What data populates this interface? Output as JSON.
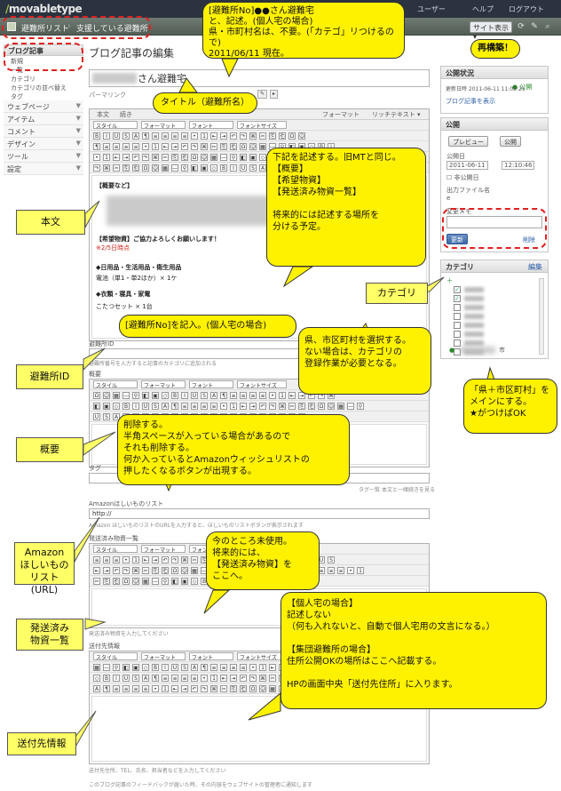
{
  "app": {
    "logo": "movabletype",
    "top_links": [
      "ユーザー",
      "ヘルプ",
      "ログアウト"
    ]
  },
  "site_bar": {
    "crumbs": [
      "避難所リスト",
      "支援している避難所"
    ],
    "view_site": "サイト表示"
  },
  "left_nav": {
    "items": [
      {
        "label": "ブログ記事",
        "sub": [
          "新規",
          "一覧",
          "カテゴリ",
          "カテゴリの並べ替え",
          "タグ"
        ]
      },
      {
        "label": "ウェブページ"
      },
      {
        "label": "アイテム"
      },
      {
        "label": "コメント"
      },
      {
        "label": "デザイン"
      },
      {
        "label": "ツール"
      },
      {
        "label": "設定"
      }
    ]
  },
  "main": {
    "page_title": "ブログ記事の編集",
    "title_value": "さん避難宅",
    "permalink_label": "パーマリンク",
    "format_label": "フォーマット",
    "format_value": "リッチテキスト",
    "editor_tabs": [
      "本文",
      "続き"
    ],
    "toolbar_selects": [
      "スタイル",
      "フォーマット",
      "フォント",
      "フォントサイズ"
    ],
    "body": {
      "section_overview": "【概要など】",
      "hope_label": "【希望物資】ご協力よろしくお願いします！",
      "hope_note": "※2/5日時点",
      "daily_label": "◆日用品・生活用品・衛生用品",
      "item_a": "電池（単1・単2ほか）× 1ケ",
      "clothes_label": "◆衣類・寝具・家電",
      "item_b": "こたつセット × 1台"
    },
    "shelter_id_label": "避難所ID",
    "shelter_id_note": "避難所番号を入力すると記事のカテゴリに追加される",
    "summary_label": "概要",
    "tags_label": "タグ",
    "tags_links": [
      "タグ一覧",
      "本文と一緒",
      "続きを見る"
    ],
    "amazon_label": "Amazonほしいものリスト",
    "amazon_value": "http://",
    "amazon_note": "Amazon ほしいものリストのURLを入力すると、ほしいものリストボタンが表示されます",
    "shipped_label": "発送済み物資一覧",
    "shipped_note": "発送済み物資を入力してください",
    "dest_label": "送付先情報",
    "dest_note": "送付先住所、TEL、氏名、担当者などを入力してください",
    "footer_text": "このブログ記事のフィードバックが届いた時、その内容をウェブサイトの管理者に通知します"
  },
  "sidebar": {
    "status_title": "公開状況",
    "status_value": "公開",
    "status_date": "更新日時 2011-06-11 11:09:21",
    "status_link": "ブログ記事を表示",
    "publish_title": "公開",
    "preview_btn": "プレビュー",
    "save_btn": "公開",
    "publish_date_label": "公開日",
    "publish_date": "2011-06-11",
    "publish_time": "12:10:46",
    "unpublish_label": "非公開日",
    "filename_label": "出力ファイル名",
    "filename_value": "e",
    "change_label": "変更メモ",
    "update_btn": "更新",
    "delete_link": "削除",
    "category_title": "カテゴリ",
    "category_action": "編集",
    "category_add": "＋",
    "category_checks": [
      true,
      true,
      false,
      false,
      false,
      false,
      false,
      false
    ],
    "primary_suffix": "市"
  },
  "annotations": {
    "top": "[避難所No]●●さん避難宅\nと、記述。(個人宅の場合)\n県・市町村名は、不要。(「カテゴ」リつけるので)\n2011/06/11 現在。",
    "rebuild": "再構築！",
    "title": "タイトル（避難所名）",
    "body": "本文",
    "body_note": "下記を記述する。旧MTと同じ。\n【概要】\n【希望物資】\n【発送済み物資一覧】\n\n将来的には記述する場所を\n分ける予定。",
    "category": "カテゴリ",
    "shelter_no": "[避難所No]を記入。(個人宅の場合)",
    "shelter_id": "避難所ID",
    "category_note": "県、市区町村を選択する。\nない場合は、カテゴリの\n登録作業が必要となる。",
    "primary_note": "「県＋市区町村」を\nメインにする。\n★がつけばOK",
    "summary": "概要",
    "summary_note": "削除する。\n半角スペースが入っている場合があるので\nそれも削除する。\n何か入っているとAmazonウィッシュリストの\n押したくなるボタンが出現する。",
    "amazon": "Amazon\nほしいもの\nリスト(URL)",
    "unused": "今のところ未使用。\n将来的には、\n【発送済み物資】を\nここへ。",
    "shipped": "発送済み\n物資一覧",
    "dest_note": "【個人宅の場合】\n記述しない\n（何も入れないと、自動で個人宅用の文言になる。）\n\n【集団避難所の場合】\n住所公開OKの場所はここへ記載する。\n\nHPの画面中央「送付先住所」に入ります。",
    "dest": "送付先情報"
  },
  "colors": {
    "callout_fill": "#fff200",
    "label_fill": "#ffff66",
    "dash_outline": "#e02020",
    "topbar": "#2b3340",
    "sitebar": "#5e6a61"
  }
}
